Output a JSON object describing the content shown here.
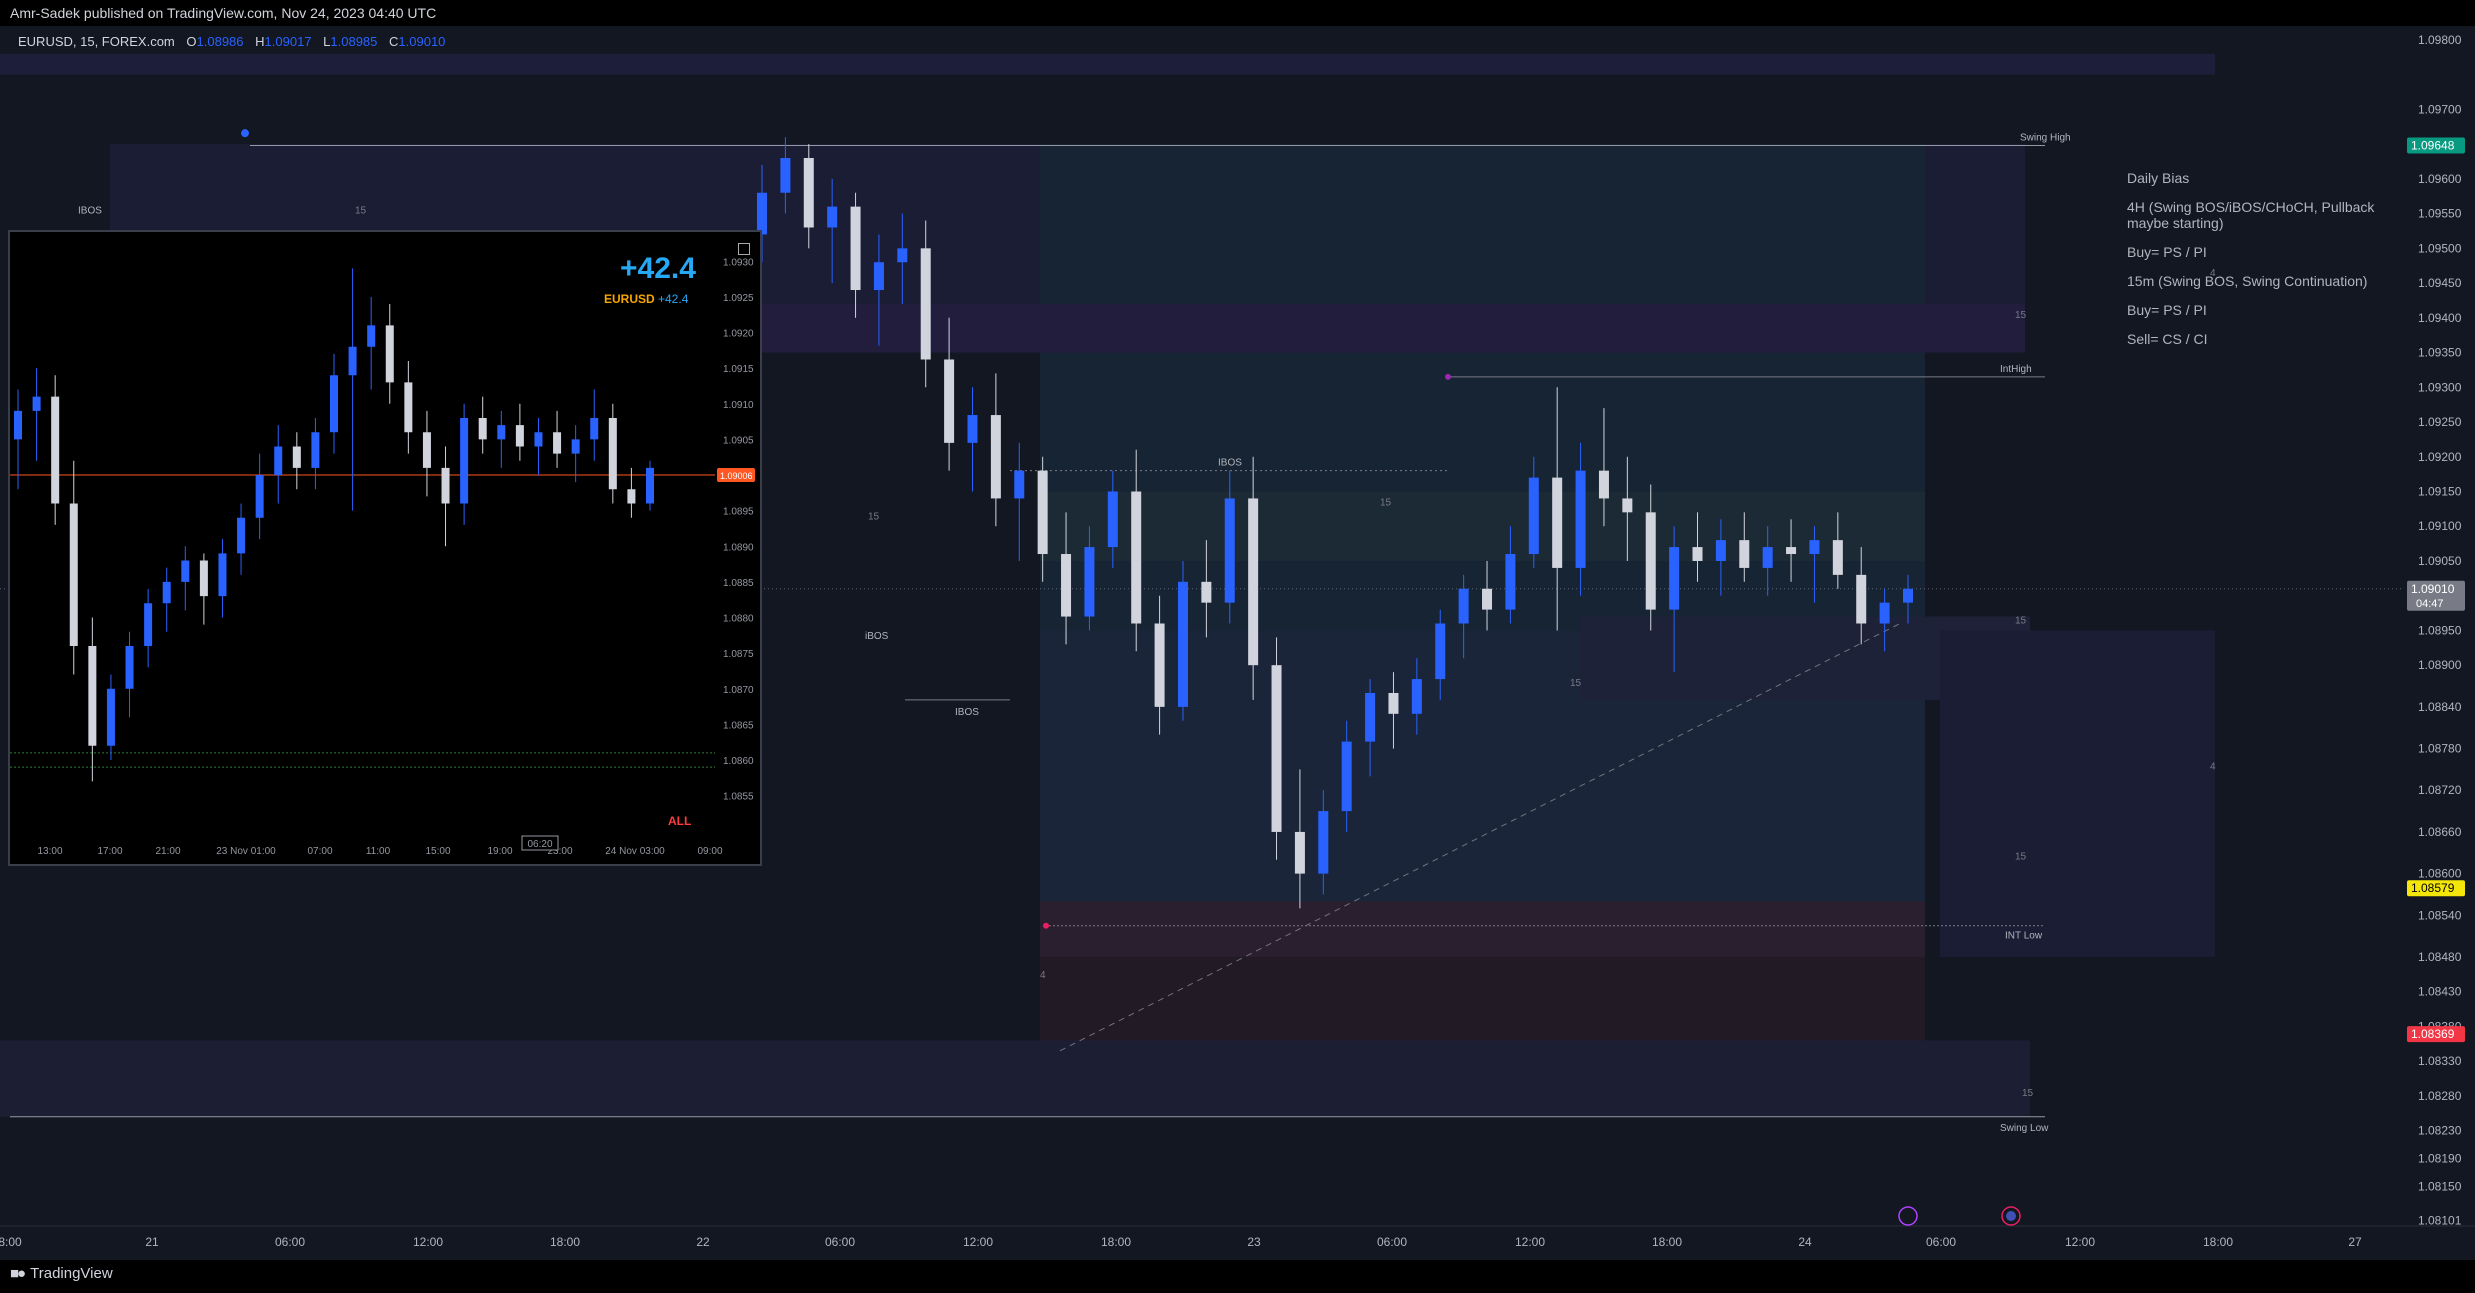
{
  "header": {
    "published": "Amr-Sadek published on TradingView.com, Nov 24, 2023 04:40 UTC"
  },
  "legend": {
    "symbol": "EURUSD, 15, FOREX.com",
    "open_key": "O",
    "open": "1.08986",
    "high_key": "H",
    "high": "1.09017",
    "low_key": "L",
    "low": "1.08985",
    "close_key": "C",
    "close": "1.09010"
  },
  "footer": {
    "brand": "TradingView"
  },
  "bias": {
    "title": "Daily Bias",
    "h4": "4H (Swing BOS/iBOS/CHoCH, Pullback maybe starting)",
    "buy1": "Buy= PS / PI",
    "m15": "15m (Swing BOS, Swing Continuation)",
    "buy2": "Buy= PS / PI",
    "sell": "Sell= CS / CI"
  },
  "chart_data": [
    {
      "type": "candlestick",
      "symbol": "EURUSD",
      "timeframe": "15",
      "ylim": [
        1.081,
        1.0982
      ],
      "y_ticks": [
        "1.09800",
        "1.09700",
        "1.09600",
        "1.09550",
        "1.09500",
        "1.09450",
        "1.09400",
        "1.09350",
        "1.09300",
        "1.09250",
        "1.09200",
        "1.09150",
        "1.09100",
        "1.09050",
        "1.08950",
        "1.08900",
        "1.08840",
        "1.08780",
        "1.08720",
        "1.08660",
        "1.08600",
        "1.08540",
        "1.08480",
        "1.08430",
        "1.08380",
        "1.08330",
        "1.08280",
        "1.08230",
        "1.08190",
        "1.08150",
        "1.08101"
      ],
      "x_ticks": [
        "8:00",
        "21",
        "06:00",
        "12:00",
        "18:00",
        "22",
        "06:00",
        "12:00",
        "18:00",
        "23",
        "06:00",
        "12:00",
        "18:00",
        "24",
        "06:00",
        "12:00",
        "18:00",
        "27"
      ],
      "price_labels": [
        {
          "value": 1.09648,
          "text": "1.09648",
          "color": "#089981"
        },
        {
          "value": 1.0901,
          "text": "1.09010",
          "sub": "04:47",
          "color": "#787b86"
        },
        {
          "value": 1.08579,
          "text": "1.08579",
          "color": "#f5e60a"
        },
        {
          "value": 1.08369,
          "text": "1.08369",
          "color": "#f23645"
        }
      ],
      "annotations": [
        "Swing High",
        "IntHigh",
        "INT Low",
        "Swing Low",
        "IBOS",
        "IBOS",
        "IBOS",
        "iBOS",
        "15",
        "15",
        "15",
        "15",
        "15",
        "15",
        "15",
        "15",
        "4",
        "4",
        "4"
      ],
      "series": [
        {
          "values": [
            [
              1.0952,
              1.0962,
              1.0948,
              1.0958
            ],
            [
              1.0958,
              1.0966,
              1.0955,
              1.0963
            ],
            [
              1.0963,
              1.0965,
              1.095,
              1.0953
            ],
            [
              1.0953,
              1.096,
              1.0945,
              1.0956
            ],
            [
              1.0956,
              1.0958,
              1.094,
              1.0944
            ],
            [
              1.0944,
              1.0952,
              1.0936,
              1.0948
            ],
            [
              1.0948,
              1.0955,
              1.0942,
              1.095
            ],
            [
              1.095,
              1.0954,
              1.093,
              1.0934
            ],
            [
              1.0934,
              1.094,
              1.0918,
              1.0922
            ],
            [
              1.0922,
              1.093,
              1.0915,
              1.0926
            ],
            [
              1.0926,
              1.0932,
              1.091,
              1.0914
            ],
            [
              1.0914,
              1.0922,
              1.0905,
              1.0918
            ],
            [
              1.0918,
              1.092,
              1.0902,
              1.0906
            ],
            [
              1.0906,
              1.0912,
              1.0893,
              1.0897
            ],
            [
              1.0897,
              1.091,
              1.0895,
              1.0907
            ],
            [
              1.0907,
              1.0918,
              1.0904,
              1.0915
            ],
            [
              1.0915,
              1.0921,
              1.0892,
              1.0896
            ],
            [
              1.0896,
              1.09,
              1.088,
              1.0884
            ],
            [
              1.0884,
              1.0905,
              1.0882,
              1.0902
            ],
            [
              1.0902,
              1.0908,
              1.0894,
              1.0899
            ],
            [
              1.0899,
              1.0918,
              1.0896,
              1.0914
            ],
            [
              1.0914,
              1.092,
              1.0885,
              1.089
            ],
            [
              1.089,
              1.0894,
              1.0862,
              1.0866
            ],
            [
              1.0866,
              1.0875,
              1.0855,
              1.086
            ],
            [
              1.086,
              1.0872,
              1.0857,
              1.0869
            ],
            [
              1.0869,
              1.0882,
              1.0866,
              1.0879
            ],
            [
              1.0879,
              1.0888,
              1.0874,
              1.0886
            ],
            [
              1.0886,
              1.0889,
              1.0878,
              1.0883
            ],
            [
              1.0883,
              1.0891,
              1.088,
              1.0888
            ],
            [
              1.0888,
              1.0898,
              1.0885,
              1.0896
            ],
            [
              1.0896,
              1.0903,
              1.0891,
              1.0901
            ],
            [
              1.0901,
              1.0905,
              1.0895,
              1.0898
            ],
            [
              1.0898,
              1.091,
              1.0896,
              1.0906
            ],
            [
              1.0906,
              1.092,
              1.0904,
              1.0917
            ],
            [
              1.0917,
              1.093,
              1.0895,
              1.0904
            ],
            [
              1.0904,
              1.0922,
              1.09,
              1.0918
            ],
            [
              1.0918,
              1.0927,
              1.091,
              1.0914
            ],
            [
              1.0914,
              1.092,
              1.0905,
              1.0912
            ],
            [
              1.0912,
              1.0916,
              1.0895,
              1.0898
            ],
            [
              1.0898,
              1.091,
              1.0889,
              1.0907
            ],
            [
              1.0907,
              1.0912,
              1.0902,
              1.0905
            ],
            [
              1.0905,
              1.0911,
              1.09,
              1.0908
            ],
            [
              1.0908,
              1.0912,
              1.0902,
              1.0904
            ],
            [
              1.0904,
              1.091,
              1.09,
              1.0907
            ],
            [
              1.0907,
              1.0911,
              1.0902,
              1.0906
            ],
            [
              1.0906,
              1.091,
              1.0899,
              1.0908
            ],
            [
              1.0908,
              1.0912,
              1.0901,
              1.0903
            ],
            [
              1.0903,
              1.0907,
              1.0893,
              1.0896
            ],
            [
              1.0896,
              1.0901,
              1.0892,
              1.0899
            ],
            [
              1.0899,
              1.0903,
              1.0896,
              1.0901
            ]
          ]
        }
      ]
    },
    {
      "type": "candlestick",
      "symbol": "EURUSD",
      "pnl": "+42.4",
      "pnl_symbol": "EURUSD",
      "pnl_value": "+42.4",
      "button": "ALL",
      "ylim": [
        1.0852,
        1.0932
      ],
      "y_ticks": [
        "1.0930",
        "1.0925",
        "1.0920",
        "1.0915",
        "1.0910",
        "1.0905",
        "1.0900",
        "1.0895",
        "1.0890",
        "1.0885",
        "1.0880",
        "1.0875",
        "1.0870",
        "1.0865",
        "1.0860",
        "1.0855"
      ],
      "price_label": "1.09006",
      "time_label": "06:20",
      "x_ticks": [
        "13:00",
        "17:00",
        "21:00",
        "23 Nov 01:00",
        "07:00",
        "11:00",
        "15:00",
        "19:00",
        "23:00",
        "24 Nov 03:00",
        "09:00"
      ],
      "series": [
        {
          "values": [
            [
              1.0905,
              1.0912,
              1.0898,
              1.0909
            ],
            [
              1.0909,
              1.0915,
              1.0902,
              1.0911
            ],
            [
              1.0911,
              1.0914,
              1.0893,
              1.0896
            ],
            [
              1.0896,
              1.0902,
              1.0872,
              1.0876
            ],
            [
              1.0876,
              1.088,
              1.0857,
              1.0862
            ],
            [
              1.0862,
              1.0872,
              1.086,
              1.087
            ],
            [
              1.087,
              1.0878,
              1.0866,
              1.0876
            ],
            [
              1.0876,
              1.0884,
              1.0873,
              1.0882
            ],
            [
              1.0882,
              1.0887,
              1.0878,
              1.0885
            ],
            [
              1.0885,
              1.089,
              1.0881,
              1.0888
            ],
            [
              1.0888,
              1.0889,
              1.0879,
              1.0883
            ],
            [
              1.0883,
              1.0891,
              1.088,
              1.0889
            ],
            [
              1.0889,
              1.0896,
              1.0886,
              1.0894
            ],
            [
              1.0894,
              1.0903,
              1.0891,
              1.09
            ],
            [
              1.09,
              1.0907,
              1.0896,
              1.0904
            ],
            [
              1.0904,
              1.0906,
              1.0898,
              1.0901
            ],
            [
              1.0901,
              1.0908,
              1.0898,
              1.0906
            ],
            [
              1.0906,
              1.0917,
              1.0903,
              1.0914
            ],
            [
              1.0914,
              1.0929,
              1.0895,
              1.0918
            ],
            [
              1.0918,
              1.0925,
              1.0912,
              1.0921
            ],
            [
              1.0921,
              1.0924,
              1.091,
              1.0913
            ],
            [
              1.0913,
              1.0916,
              1.0903,
              1.0906
            ],
            [
              1.0906,
              1.0909,
              1.0897,
              1.0901
            ],
            [
              1.0901,
              1.0904,
              1.089,
              1.0896
            ],
            [
              1.0896,
              1.091,
              1.0893,
              1.0908
            ],
            [
              1.0908,
              1.0911,
              1.0903,
              1.0905
            ],
            [
              1.0905,
              1.0909,
              1.0901,
              1.0907
            ],
            [
              1.0907,
              1.091,
              1.0902,
              1.0904
            ],
            [
              1.0904,
              1.0908,
              1.09,
              1.0906
            ],
            [
              1.0906,
              1.0909,
              1.0901,
              1.0903
            ],
            [
              1.0903,
              1.0907,
              1.0899,
              1.0905
            ],
            [
              1.0905,
              1.0912,
              1.0902,
              1.0908
            ],
            [
              1.0908,
              1.091,
              1.0896,
              1.0898
            ],
            [
              1.0898,
              1.0901,
              1.0894,
              1.0896
            ],
            [
              1.0896,
              1.0902,
              1.0895,
              1.0901
            ]
          ]
        }
      ]
    }
  ]
}
